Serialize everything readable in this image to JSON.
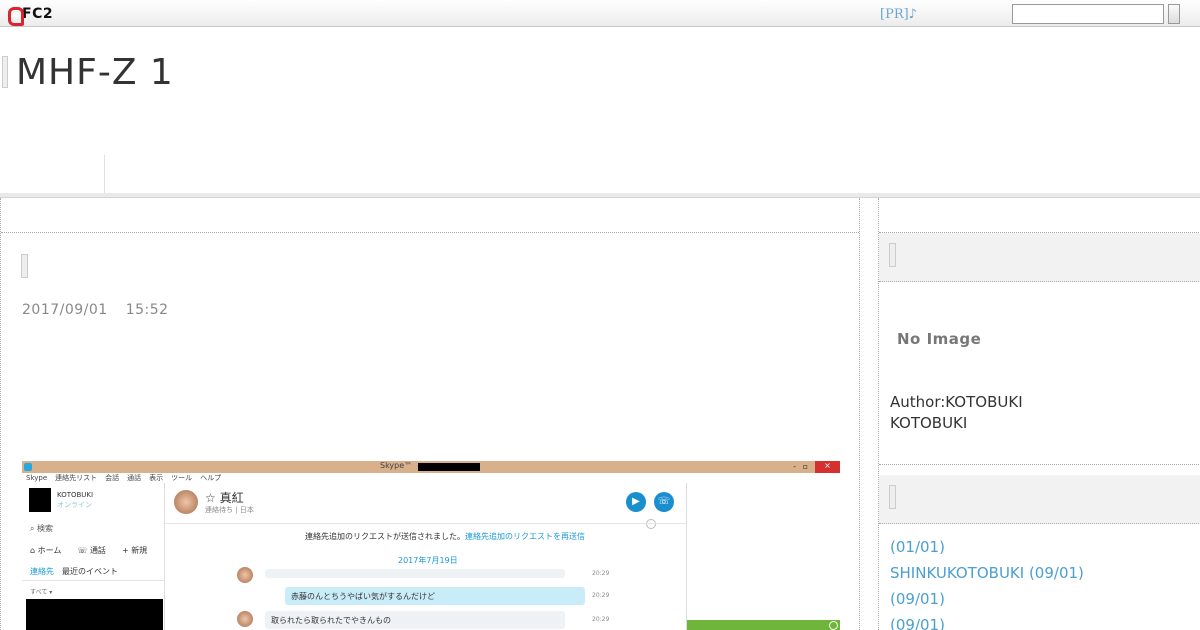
{
  "fc2bar": {
    "logo_text": "FC2",
    "pr_link": "[PR]♪",
    "search_value": ""
  },
  "header": {
    "blog_title": "MHF-Z 1"
  },
  "entry": {
    "date": "2017/09/01",
    "time": "15:52"
  },
  "screenshot": {
    "window_title": "Skype™",
    "window_controls": [
      "-",
      "▫",
      "×"
    ],
    "menu": [
      "Skype",
      "連絡先リスト",
      "会話",
      "通話",
      "表示",
      "ツール",
      "ヘルプ"
    ],
    "sidebar": {
      "user_name": "KOTOBUKI",
      "status": "オンライン",
      "search_label": "検索",
      "nav": [
        "ホーム",
        "通話",
        "新規"
      ],
      "tabs": [
        "連絡先",
        "最近のイベント"
      ],
      "filter_label": "すべて"
    },
    "chat": {
      "contact_name": "☆ 真紅",
      "contact_sub": "連絡待ち | 日本",
      "notice_text": "連絡先追加のリクエストが送信されました。",
      "notice_link": "連絡先追加のリクエストを再送信",
      "date_label": "2017年7月19日",
      "messages": [
        {
          "text": "",
          "time": "20:29"
        },
        {
          "text": "赤藤のんとちうやばい気がするんだけど",
          "time": "20:29"
        },
        {
          "text": "取られたら取られたでやきんもの",
          "time": "20:29"
        }
      ]
    }
  },
  "sidebar": {
    "profile_image": "No Image",
    "author_label": "Author:KOTOBUKI",
    "author_name": "KOTOBUKI",
    "recent_entries": [
      " (01/01)",
      "SHINKUKOTOBUKI (09/01)",
      " (09/01)",
      " (09/01)"
    ]
  }
}
